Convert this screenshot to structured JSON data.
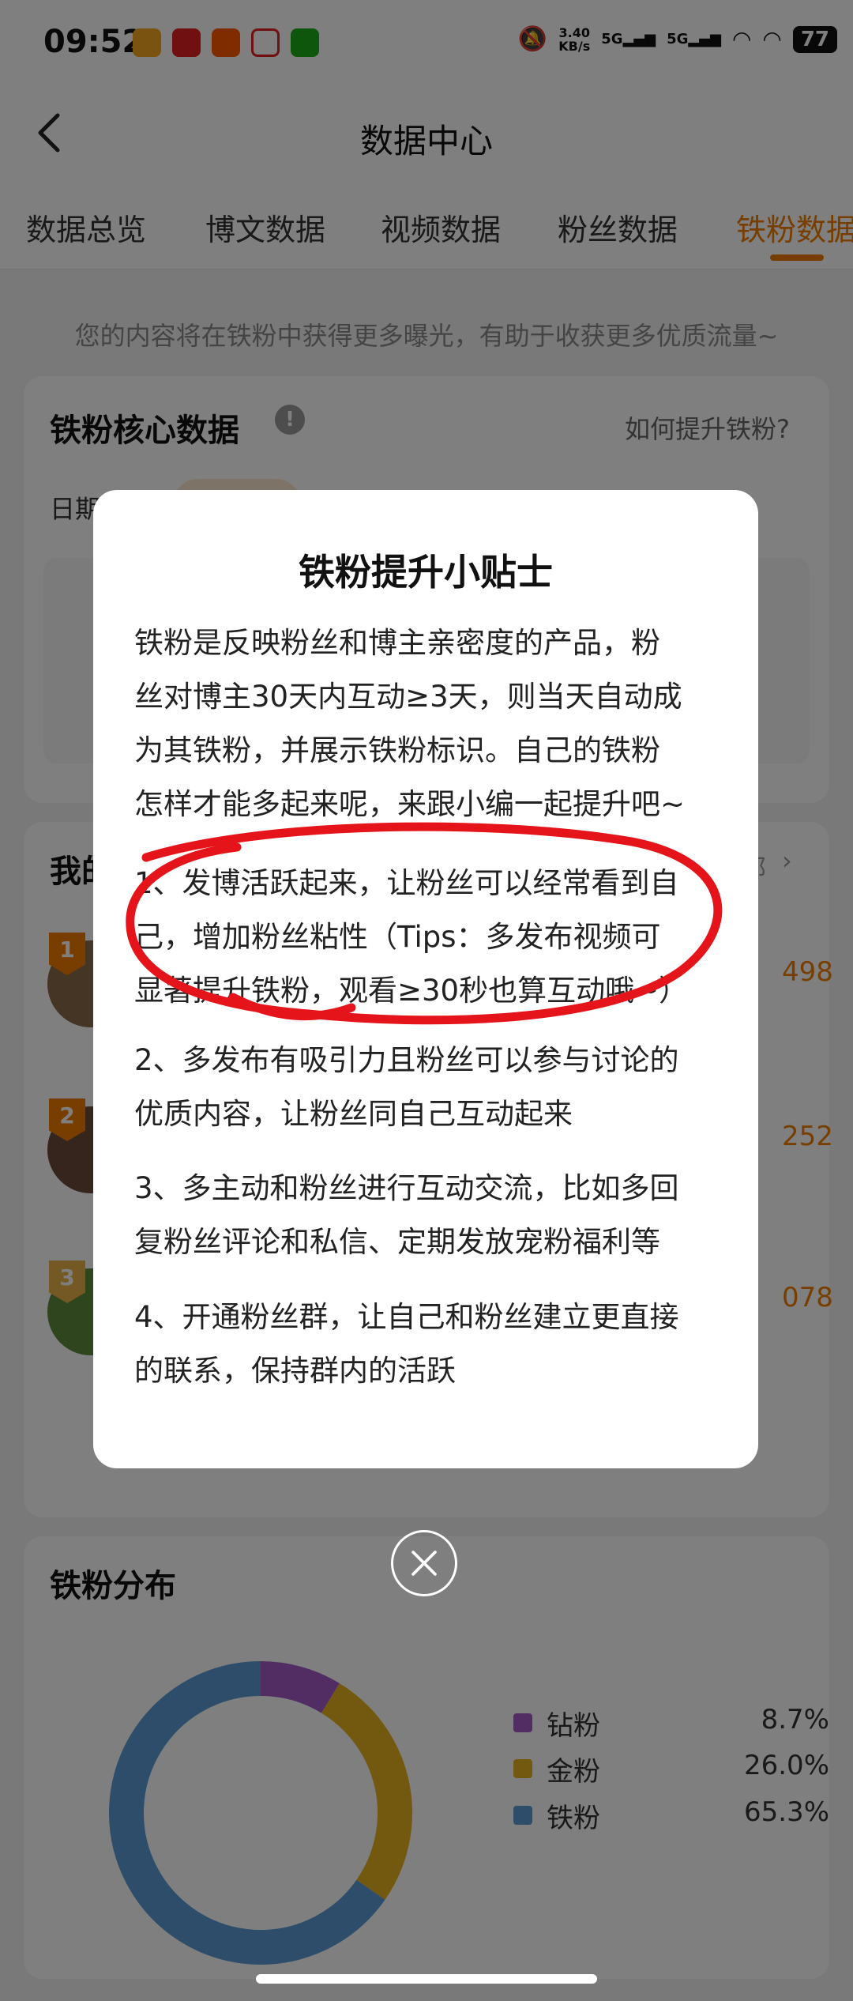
{
  "status_bar": {
    "time": "09:52",
    "net_speed_value": "3.40",
    "net_speed_unit": "KB/s",
    "sig1": "5G",
    "sig2": "5G",
    "battery": "77"
  },
  "header": {
    "title": "数据中心"
  },
  "tabs": [
    "数据总览",
    "博文数据",
    "视频数据",
    "粉丝数据",
    "铁粉数据"
  ],
  "hint": "您的内容将在铁粉中获得更多曝光，有助于收获更多优质流量~",
  "core": {
    "title": "铁粉核心数据",
    "help_icon": "!",
    "link": "如何提升铁粉?",
    "date_label": "日期"
  },
  "my_section": {
    "title_fragment": "我的",
    "right_fragment": "部",
    "ranks": [
      {
        "rank": "1",
        "value": "498"
      },
      {
        "rank": "2",
        "value": "252"
      },
      {
        "rank": "3",
        "value": "078"
      }
    ]
  },
  "distribution": {
    "title": "铁粉分布",
    "legend": [
      {
        "name": "钻粉",
        "value": "8.7%",
        "color": "#a45bc9"
      },
      {
        "name": "金粉",
        "value": "26.0%",
        "color": "#e6b020"
      },
      {
        "name": "铁粉",
        "value": "65.3%",
        "color": "#5b9bd5"
      }
    ]
  },
  "modal": {
    "title": "铁粉提升小贴士",
    "intro": [
      "铁粉是反映粉丝和博主亲密度的产品，粉",
      "丝对博主30天内互动≥3天，则当天自动成",
      "为其铁粉，并展示铁粉标识。自己的铁粉",
      "怎样才能多起来呢，来跟小编一起提升吧~"
    ],
    "tip1": [
      "1、发博活跃起来，让粉丝可以经常看到自",
      "己，增加粉丝粘性（Tips：多发布视频可",
      "显著提升铁粉，观看≥30秒也算互动哦~）"
    ],
    "tip2": [
      "2、多发布有吸引力且粉丝可以参与讨论的",
      "优质内容，让粉丝同自己互动起来"
    ],
    "tip3": [
      "3、多主动和粉丝进行互动交流，比如多回",
      "复粉丝评论和私信、定期发放宠粉福利等"
    ],
    "tip4": [
      "4、开通粉丝群，让自己和粉丝建立更直接",
      "的联系，保持群内的活跃"
    ]
  },
  "chart_data": {
    "type": "pie",
    "categories": [
      "钻粉",
      "金粉",
      "铁粉"
    ],
    "values": [
      8.7,
      26.0,
      65.3
    ],
    "title": "铁粉分布"
  }
}
